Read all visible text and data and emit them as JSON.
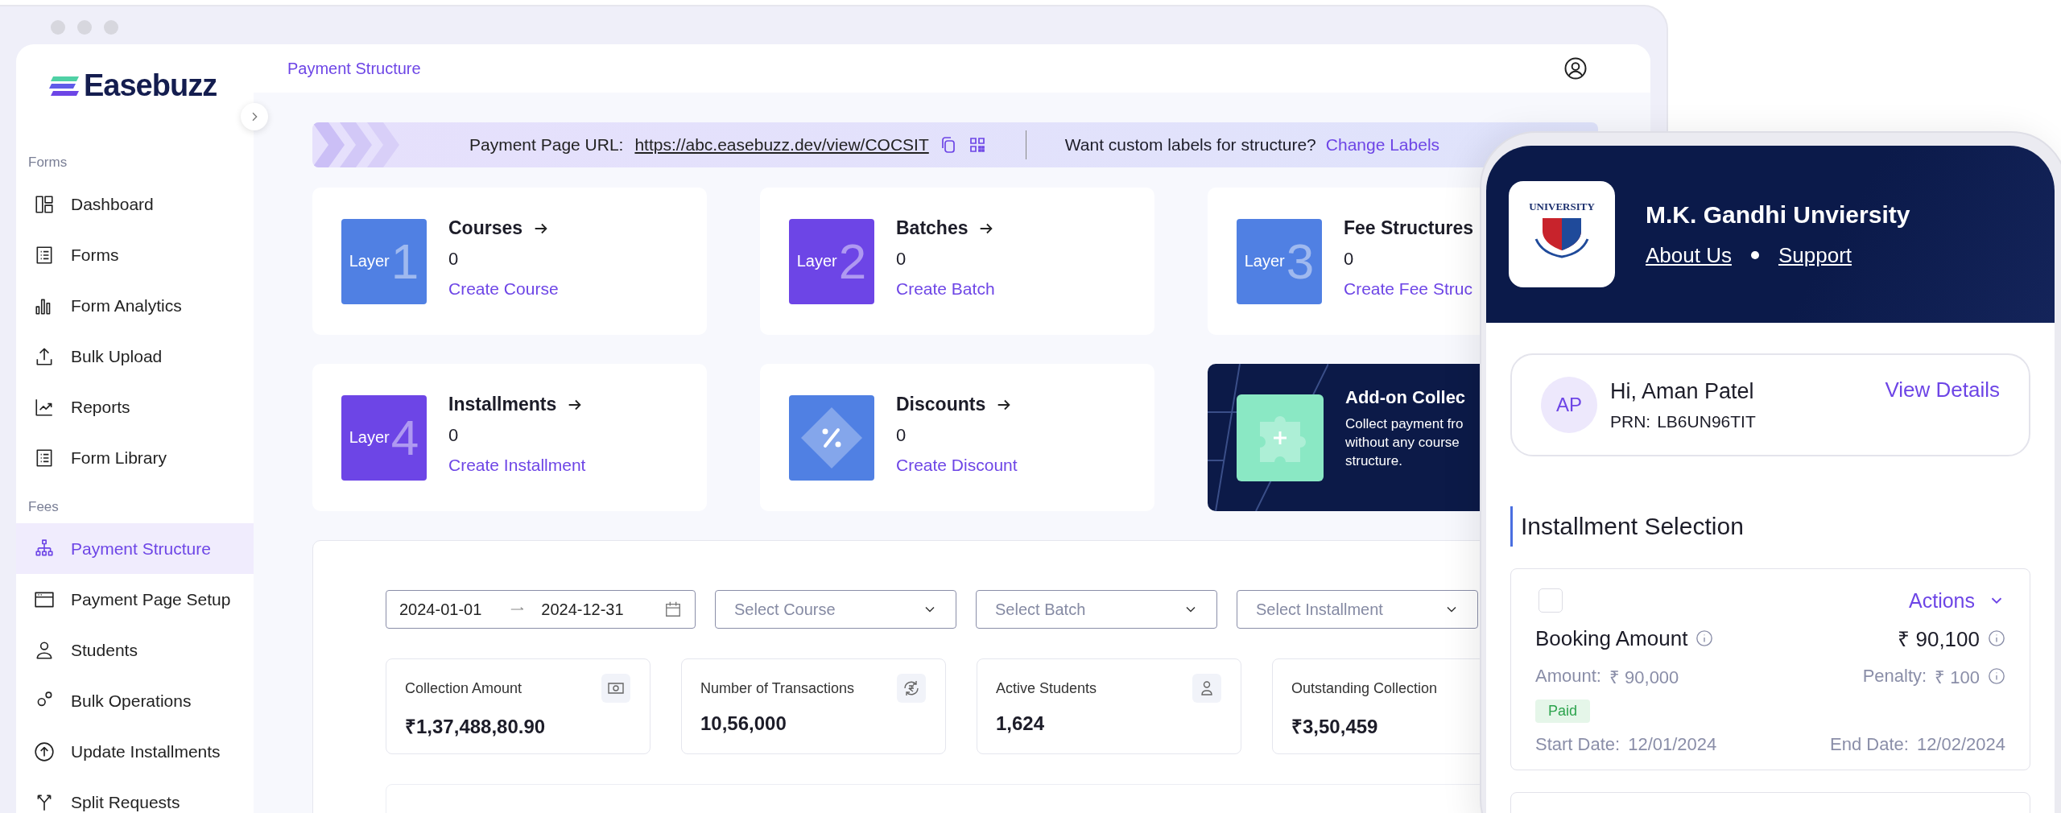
{
  "brand": {
    "name": "Easebuzz"
  },
  "sidebar": {
    "sections": [
      {
        "label": "Forms",
        "items": [
          {
            "label": "Dashboard",
            "selected": false
          },
          {
            "label": "Forms",
            "selected": false
          },
          {
            "label": "Form Analytics",
            "selected": false
          },
          {
            "label": "Bulk Upload",
            "selected": false
          },
          {
            "label": "Reports",
            "selected": false
          },
          {
            "label": "Form Library",
            "selected": false
          }
        ]
      },
      {
        "label": "Fees",
        "items": [
          {
            "label": "Payment Structure",
            "selected": true
          },
          {
            "label": "Payment Page Setup",
            "selected": false
          },
          {
            "label": "Students",
            "selected": false
          },
          {
            "label": "Bulk Operations",
            "selected": false
          },
          {
            "label": "Update Installments",
            "selected": false
          },
          {
            "label": "Split Requests",
            "selected": false
          }
        ]
      }
    ]
  },
  "topbar": {
    "title": "Payment Structure"
  },
  "url_banner": {
    "label": "Payment Page URL:",
    "url": "https://abc.easebuzz.dev/view/COCSIT",
    "prompt": "Want custom labels for structure?",
    "link": "Change Labels"
  },
  "layers": [
    {
      "kind": "layer",
      "tile_label": "Layer",
      "number": "1",
      "color": "#5080e3",
      "arrow": true,
      "title": "Courses",
      "count": "0",
      "action": "Create Course"
    },
    {
      "kind": "layer",
      "tile_label": "Layer",
      "number": "2",
      "color": "#6d45e6",
      "arrow": true,
      "title": "Batches",
      "count": "0",
      "action": "Create Batch"
    },
    {
      "kind": "layer",
      "tile_label": "Layer",
      "number": "3",
      "color": "#5080e3",
      "arrow": false,
      "title": "Fee Structures",
      "count": "0",
      "action": "Create Fee Struc"
    },
    {
      "kind": "layer",
      "tile_label": "Layer",
      "number": "4",
      "color": "#6d45e6",
      "arrow": true,
      "title": "Installments",
      "count": "0",
      "action": "Create Installment"
    },
    {
      "kind": "discount",
      "color": "#5080e3",
      "arrow": true,
      "title": "Discounts",
      "count": "0",
      "action": "Create Discount"
    },
    {
      "kind": "promo",
      "title": "Add-on Collec",
      "lines": [
        "Collect payment fro",
        "without any course",
        "structure."
      ]
    }
  ],
  "filters": {
    "date_from": "2024-01-01",
    "date_to": "2024-12-31",
    "selects": [
      {
        "placeholder": "Select Course"
      },
      {
        "placeholder": "Select Batch"
      },
      {
        "placeholder": "Select Installment"
      }
    ]
  },
  "stats": [
    {
      "label": "Collection Amount",
      "value": "₹1,37,488,80.90"
    },
    {
      "label": "Number of Transactions",
      "value": "10,56,000"
    },
    {
      "label": "Active Students",
      "value": "1,624"
    },
    {
      "label": "Outstanding Collection",
      "value": "₹3,50,459"
    }
  ],
  "phone": {
    "university": {
      "name": "M.K. Gandhi Unviersity",
      "logo_text": "UNIVERSITY",
      "links": [
        "About Us",
        "Support"
      ]
    },
    "student": {
      "initials": "AP",
      "greeting": "Hi, Aman Patel",
      "prn_label": "PRN:",
      "prn": "LB6UN96TIT",
      "details_link": "View Details"
    },
    "section_title": "Installment Selection",
    "installments": [
      {
        "checked": false,
        "actions": "Actions",
        "name": "Booking Amount",
        "total": "₹ 90,100",
        "amount_label": "Amount:",
        "amount": "₹ 90,000",
        "penalty_label": "Penalty:",
        "penalty": "₹ 100",
        "status": "Paid",
        "start_label": "Start Date:",
        "start": "12/01/2024",
        "end_label": "End Date:",
        "end": "12/02/2024"
      }
    ]
  }
}
